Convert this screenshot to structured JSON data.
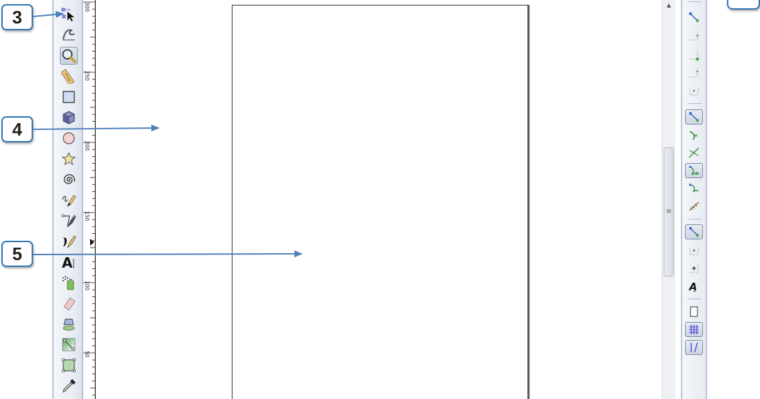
{
  "callouts": {
    "c3": "3",
    "c4": "4",
    "c5": "5"
  },
  "toolbox": {
    "tools": [
      {
        "name": "node-tool-icon",
        "active": false
      },
      {
        "name": "tweak-tool-icon",
        "active": false
      },
      {
        "name": "zoom-tool-icon",
        "active": true
      },
      {
        "name": "measure-tool-icon",
        "active": false
      },
      {
        "name": "rectangle-tool-icon",
        "active": false
      },
      {
        "name": "3d-box-tool-icon",
        "active": false
      },
      {
        "name": "ellipse-tool-icon",
        "active": false
      },
      {
        "name": "star-tool-icon",
        "active": false
      },
      {
        "name": "spiral-tool-icon",
        "active": false
      },
      {
        "name": "pencil-tool-icon",
        "active": false
      },
      {
        "name": "pen-tool-icon",
        "active": false
      },
      {
        "name": "calligraphy-tool-icon",
        "active": false
      },
      {
        "name": "text-tool-icon",
        "active": false
      },
      {
        "name": "spray-tool-icon",
        "active": false
      },
      {
        "name": "eraser-tool-icon",
        "active": false
      },
      {
        "name": "paint-bucket-tool-icon",
        "active": false
      },
      {
        "name": "gradient-tool-icon",
        "active": false
      },
      {
        "name": "mesh-tool-icon",
        "active": false
      },
      {
        "name": "dropper-tool-icon",
        "active": false
      }
    ]
  },
  "ruler": {
    "labels": [
      "300",
      "250",
      "200",
      "150",
      "100",
      "50"
    ]
  },
  "snapbar": {
    "buttons": [
      {
        "name": "snap-bbox-icon",
        "active": false
      },
      {
        "name": "snap-bbox-edge-icon",
        "active": false
      },
      {
        "name": "snap-bbox-corner-icon",
        "active": false
      },
      {
        "name": "snap-bbox-midpoint-icon",
        "active": false
      },
      {
        "name": "snap-bbox-center-icon",
        "active": false
      },
      {
        "name": "snap-nodes-icon",
        "active": true
      },
      {
        "name": "snap-paths-icon",
        "active": false
      },
      {
        "name": "snap-intersections-icon",
        "active": false
      },
      {
        "name": "snap-cusp-nodes-icon",
        "active": true
      },
      {
        "name": "snap-smooth-nodes-icon",
        "active": false
      },
      {
        "name": "snap-line-midpoints-icon",
        "active": false
      },
      {
        "name": "snap-others-icon",
        "active": true
      },
      {
        "name": "snap-object-center-icon",
        "active": false
      },
      {
        "name": "snap-rotation-center-icon",
        "active": false
      },
      {
        "name": "snap-text-baseline-icon",
        "active": false
      },
      {
        "name": "snap-page-border-icon",
        "active": false
      },
      {
        "name": "snap-grid-icon",
        "active": true
      },
      {
        "name": "snap-guides-icon",
        "active": true
      }
    ]
  }
}
